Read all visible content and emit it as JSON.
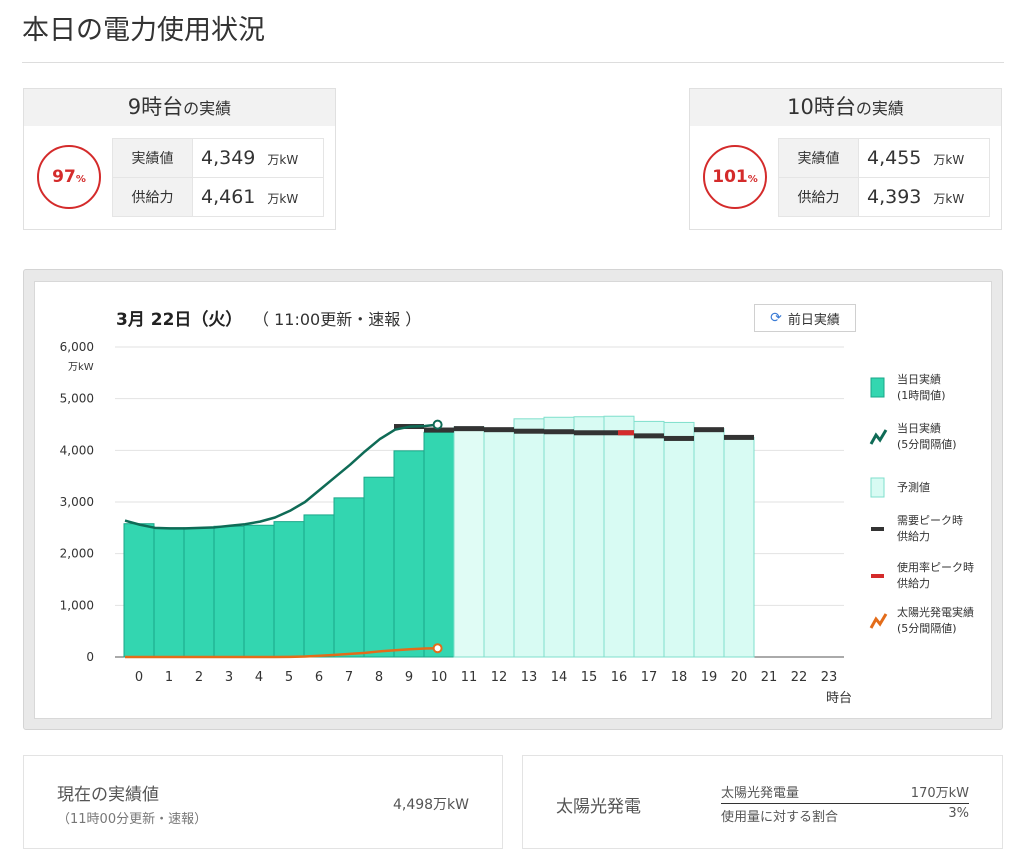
{
  "page": {
    "title": "本日の電力使用状況"
  },
  "result_left": {
    "hour": "9時台",
    "suffix": "の実績",
    "rate": "97",
    "rate_unit": "%",
    "rows": [
      {
        "label": "実績値",
        "value": "4,349",
        "unit": "万kW"
      },
      {
        "label": "供給力",
        "value": "4,461",
        "unit": "万kW"
      }
    ]
  },
  "result_right": {
    "hour": "10時台",
    "suffix": "の実績",
    "rate": "101",
    "rate_unit": "%",
    "rows": [
      {
        "label": "実績値",
        "value": "4,455",
        "unit": "万kW"
      },
      {
        "label": "供給力",
        "value": "4,393",
        "unit": "万kW"
      }
    ]
  },
  "chart": {
    "date": "3月 22日（火）",
    "update": "（ 11:00更新・速報 ）",
    "prev_button": "前日実績",
    "unit": "万kW",
    "xlabel": "時台"
  },
  "chart_data": {
    "type": "bar",
    "ylim": [
      0,
      6000
    ],
    "yticks": [
      0,
      1000,
      2000,
      3000,
      4000,
      5000,
      6000
    ],
    "ytick_labels": [
      "0",
      "1,000",
      "2,000",
      "3,000",
      "4,000",
      "5,000",
      "6,000"
    ],
    "categories": [
      "0",
      "1",
      "2",
      "3",
      "4",
      "5",
      "6",
      "7",
      "8",
      "9",
      "10",
      "11",
      "12",
      "13",
      "14",
      "15",
      "16",
      "17",
      "18",
      "19",
      "20",
      "21",
      "22",
      "23"
    ],
    "actual_hourly": [
      2580,
      2500,
      2500,
      2530,
      2550,
      2620,
      2750,
      3080,
      3480,
      3990,
      4349,
      4455
    ],
    "forecast": [
      null,
      null,
      null,
      null,
      null,
      null,
      null,
      null,
      null,
      null,
      null,
      4430,
      4430,
      4610,
      4640,
      4650,
      4660,
      4560,
      4540,
      4420,
      4250,
      null,
      null,
      null
    ],
    "peak_supply": [
      null,
      null,
      null,
      null,
      null,
      null,
      null,
      null,
      null,
      4461,
      4393,
      4420,
      4400,
      4370,
      4360,
      4340,
      4340,
      4280,
      4230,
      4400,
      4250,
      null,
      null,
      null
    ],
    "peak_rate_supply_hour": 16,
    "five_min_actual": {
      "x": [
        0,
        0.5,
        1,
        1.5,
        2,
        2.5,
        3,
        3.5,
        4,
        4.5,
        5,
        5.5,
        6,
        6.5,
        7,
        7.5,
        8,
        8.5,
        9,
        9.5,
        10,
        10.42
      ],
      "y": [
        2640,
        2560,
        2500,
        2490,
        2490,
        2500,
        2510,
        2540,
        2570,
        2620,
        2700,
        2830,
        3000,
        3240,
        3480,
        3720,
        3980,
        4220,
        4400,
        4460,
        4470,
        4498
      ]
    },
    "solar_five_min": {
      "x": [
        0,
        1,
        2,
        3,
        4,
        5,
        5.5,
        6,
        6.5,
        7,
        7.5,
        8,
        8.5,
        9,
        9.5,
        10,
        10.42
      ],
      "y": [
        0,
        0,
        0,
        0,
        0,
        0,
        3,
        10,
        25,
        40,
        60,
        80,
        110,
        130,
        150,
        165,
        170
      ]
    },
    "legend": [
      {
        "key": "actual_hourly",
        "label1": "当日実績",
        "label2": "(1時間値)",
        "color": "#33d6b0"
      },
      {
        "key": "five_min_actual",
        "label1": "当日実績",
        "label2": "(5分間隔値)",
        "color": "#0f6b56"
      },
      {
        "key": "forecast",
        "label1": "予測値",
        "label2": "",
        "color": "#d8fbf3"
      },
      {
        "key": "peak_supply",
        "label1": "需要ピーク時",
        "label2": "供給力",
        "color": "#333333"
      },
      {
        "key": "peak_rate_supply",
        "label1": "使用率ピーク時",
        "label2": "供給力",
        "color": "#d42b2b"
      },
      {
        "key": "solar_five_min",
        "label1": "太陽光発電実績",
        "label2": "(5分間隔値)",
        "color": "#e36c1a"
      }
    ]
  },
  "current": {
    "label": "現在の実績値",
    "sub": "（11時00分更新・速報）",
    "value": "4,498万kW"
  },
  "solar": {
    "title": "太陽光発電",
    "rows": [
      {
        "label": "太陽光発電量",
        "value": "170万kW"
      },
      {
        "label": "使用量に対する割合",
        "value": "3%"
      }
    ]
  }
}
